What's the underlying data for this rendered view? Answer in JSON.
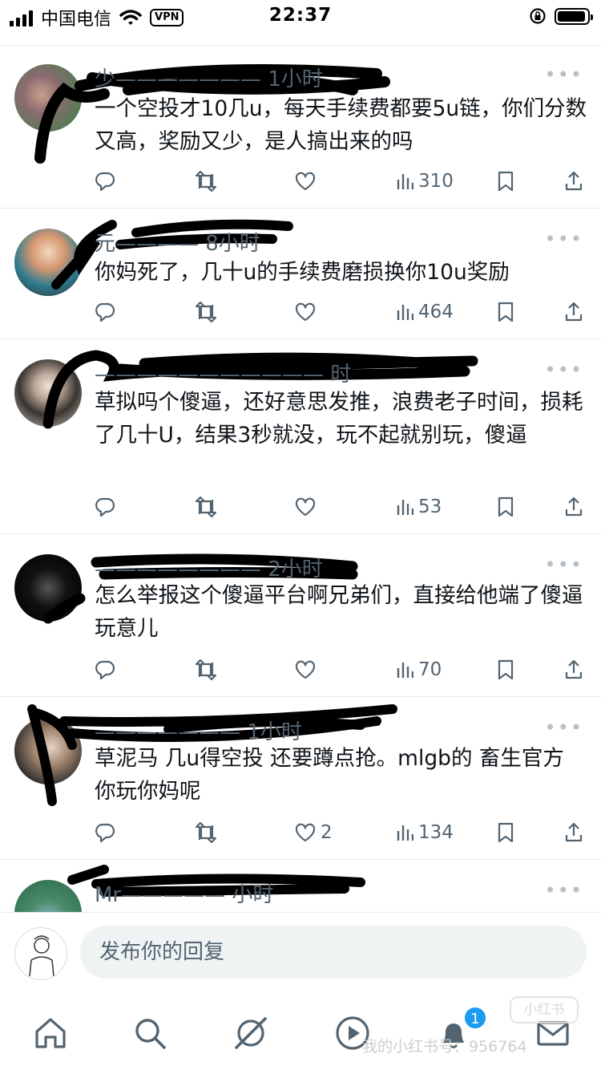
{
  "status_bar": {
    "carrier": "中国电信",
    "vpn": "VPN",
    "time": "22:37",
    "battery_level": 0.95
  },
  "tweets": [
    {
      "handle": "少——————— 1小时",
      "text": "一个空投才10几u，每天手续费都要5u链，你们分数又高，奖励又少，是人搞出来的吗",
      "replies": "",
      "retweets": "",
      "likes": "",
      "views": "310"
    },
    {
      "handle": "元———— 8小时",
      "text": "你妈死了，几十u的手续费磨损换你10u奖励",
      "replies": "",
      "retweets": "",
      "likes": "",
      "views": "464"
    },
    {
      "handle": "——————————— 时",
      "text": "草拟吗个傻逼，还好意思发推，浪费老子时间，损耗了几十U，结果3秒就没，玩不起就别玩，傻逼",
      "replies": "",
      "retweets": "",
      "likes": "",
      "views": "53"
    },
    {
      "handle": "———————— 2小时",
      "text": "怎么举报这个傻逼平台啊兄弟们，直接给他端了傻逼玩意儿",
      "replies": "",
      "retweets": "",
      "likes": "",
      "views": "70"
    },
    {
      "handle": "——————— 1小时",
      "text": "草泥马 几u得空投 还要蹲点抢。mlgb的 畜生官方 你玩你妈呢",
      "replies": "",
      "retweets": "",
      "likes": "2",
      "views": "134"
    },
    {
      "handle": "Mr————— 小时",
      "text": "",
      "replies": "",
      "retweets": "",
      "likes": "",
      "views": ""
    }
  ],
  "reply_bar": {
    "placeholder": "发布你的回复"
  },
  "tab_bar": {
    "notifications_badge": "1",
    "watermark": "我的小红书号：956764",
    "watermark_logo": "小红书"
  },
  "icons": {
    "reply": "reply-icon",
    "retweet": "retweet-icon",
    "like": "heart-icon",
    "views": "views-icon",
    "bookmark": "bookmark-icon",
    "share": "share-icon"
  },
  "colors": {
    "muted_text": "#536471",
    "accent": "#1d9bf0",
    "divider": "#e6e9ec",
    "redaction": "#000000"
  }
}
